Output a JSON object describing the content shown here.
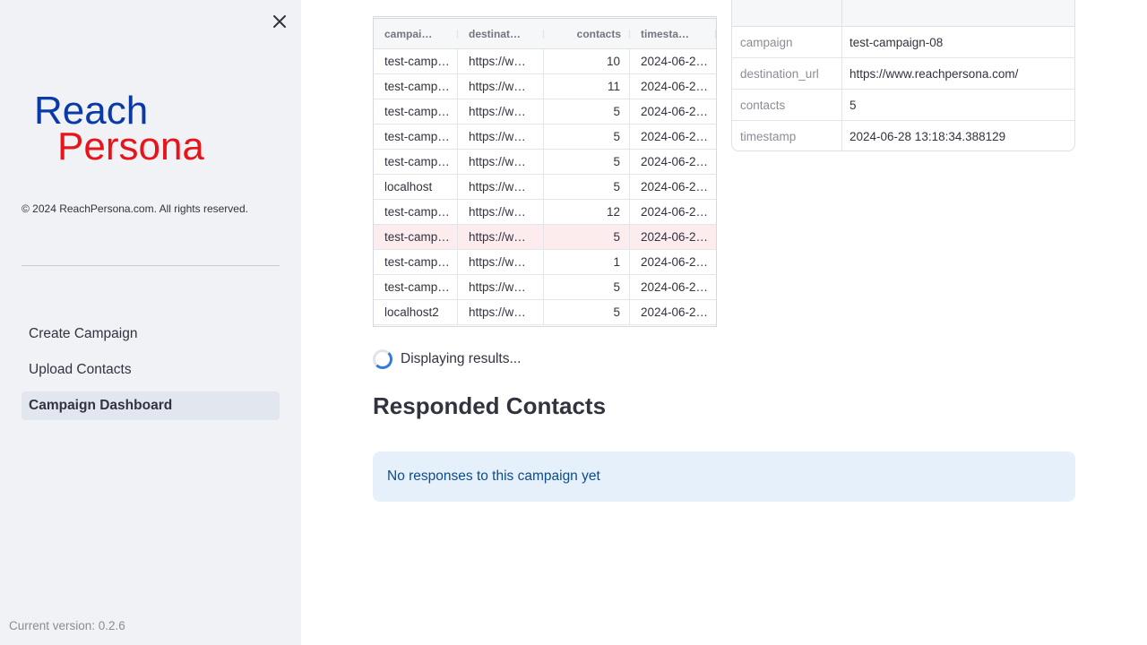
{
  "sidebar": {
    "logo": {
      "line1": "Reach",
      "line2": "Persona",
      "color1": "#0a3aa8",
      "color2": "#e8141b"
    },
    "copyright": "© 2024 ReachPersona.com. All rights reserved.",
    "nav": [
      {
        "label": "Create Campaign",
        "active": false
      },
      {
        "label": "Upload Contacts",
        "active": false
      },
      {
        "label": "Campaign Dashboard",
        "active": true
      }
    ],
    "version": "Current version: 0.2.6",
    "close_icon": "close-icon"
  },
  "grid": {
    "columns": [
      "campai…",
      "destinat…",
      "contacts",
      "timesta…"
    ],
    "rows": [
      [
        "test-camp…",
        "https://w…",
        "10",
        "2024-06-2…"
      ],
      [
        "test-camp…",
        "https://w…",
        "11",
        "2024-06-2…"
      ],
      [
        "test-camp…",
        "https://w…",
        "5",
        "2024-06-2…"
      ],
      [
        "test-camp…",
        "https://w…",
        "5",
        "2024-06-2…"
      ],
      [
        "test-camp…",
        "https://w…",
        "5",
        "2024-06-2…"
      ],
      [
        "localhost",
        "https://w…",
        "5",
        "2024-06-2…"
      ],
      [
        "test-camp…",
        "https://w…",
        "12",
        "2024-06-2…"
      ],
      [
        "test-camp…",
        "https://w…",
        "5",
        "2024-06-2…"
      ],
      [
        "test-camp…",
        "https://w…",
        "1",
        "2024-06-2…"
      ],
      [
        "test-camp…",
        "https://w…",
        "5",
        "2024-06-2…"
      ],
      [
        "localhost2",
        "https://w…",
        "5",
        "2024-06-2…"
      ]
    ],
    "selected_row": 7
  },
  "detail": {
    "rows": [
      {
        "key": "campaign",
        "value": "test-campaign-08"
      },
      {
        "key": "destination_url",
        "value": "https://www.reachpersona.com/"
      },
      {
        "key": "contacts",
        "value": "5"
      },
      {
        "key": "timestamp",
        "value": "2024-06-28 13:18:34.388129"
      }
    ]
  },
  "status": {
    "text": "Displaying results..."
  },
  "responded": {
    "title": "Responded Contacts",
    "message": "No responses to this campaign yet"
  }
}
